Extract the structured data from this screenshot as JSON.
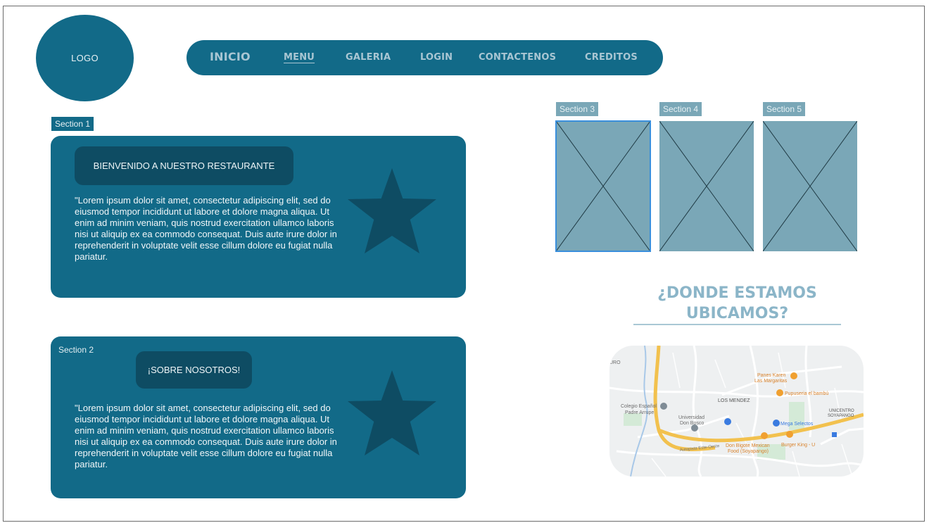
{
  "logo": {
    "label": "LOGO"
  },
  "nav": {
    "items": [
      {
        "label": "INICIO"
      },
      {
        "label": "MENU"
      },
      {
        "label": "GALERIA"
      },
      {
        "label": "LOGIN"
      },
      {
        "label": "CONTACTENOS"
      },
      {
        "label": "CREDITOS"
      }
    ]
  },
  "section1": {
    "tag": "Section 1",
    "title": "BIENVENIDO A NUESTRO RESTAURANTE",
    "body": "\"Lorem ipsum dolor sit amet, consectetur adipiscing elit, sed do eiusmod tempor incididunt ut labore et dolore magna aliqua. Ut enim ad minim veniam, quis nostrud exercitation ullamco laboris nisi ut aliquip ex ea commodo consequat. Duis aute irure dolor in reprehenderit in voluptate velit esse cillum dolore eu fugiat nulla pariatur.",
    "icon": "star-icon"
  },
  "section2": {
    "tag": "Section 2",
    "title": "¡SOBRE NOSOTROS!",
    "body": "\"Lorem ipsum dolor sit amet, consectetur adipiscing elit, sed do eiusmod tempor incididunt ut labore et dolore magna aliqua. Ut enim ad minim veniam, quis nostrud exercitation ullamco laboris nisi ut aliquip ex ea commodo consequat. Duis aute irure dolor in reprehenderit in voluptate velit esse cillum dolore eu fugiat nulla pariatur.",
    "icon": "star-icon"
  },
  "gallery": {
    "sections": [
      {
        "tag": "Section 3",
        "icon": "image-placeholder-icon"
      },
      {
        "tag": "Section 4",
        "icon": "image-placeholder-icon"
      },
      {
        "tag": "Section 5",
        "icon": "image-placeholder-icon"
      }
    ]
  },
  "location": {
    "heading_line1": "¿DONDE ESTAMOS",
    "heading_line2": "UBICAMOS?",
    "map": {
      "labels": {
        "colegio": "Colegio Español",
        "padre": "Padre Arrupe",
        "universidad": "Universidad",
        "don_bosco": "Don Bosco",
        "los_mendez": "LOS MENDEZ",
        "unicentro": "UNICENTRO",
        "soyapango": "SOYAPANGO",
        "panes1": "Panes Karen",
        "panes2": "Las Margaritas",
        "pupuseria": "Pupuseria el bambú",
        "mega": "Mega Selectos",
        "bigote1": "Don Bigote Mexican",
        "bigote2": "Food (Soyapango)",
        "burger": "Burger King - U",
        "avenue": "Autopista Este-Oeste",
        "uro": "URO"
      }
    }
  },
  "colors": {
    "primary": "#126a88",
    "dark": "#0e4c63",
    "placeholder": "#7aa7b7",
    "heading": "#8bb5c8"
  }
}
